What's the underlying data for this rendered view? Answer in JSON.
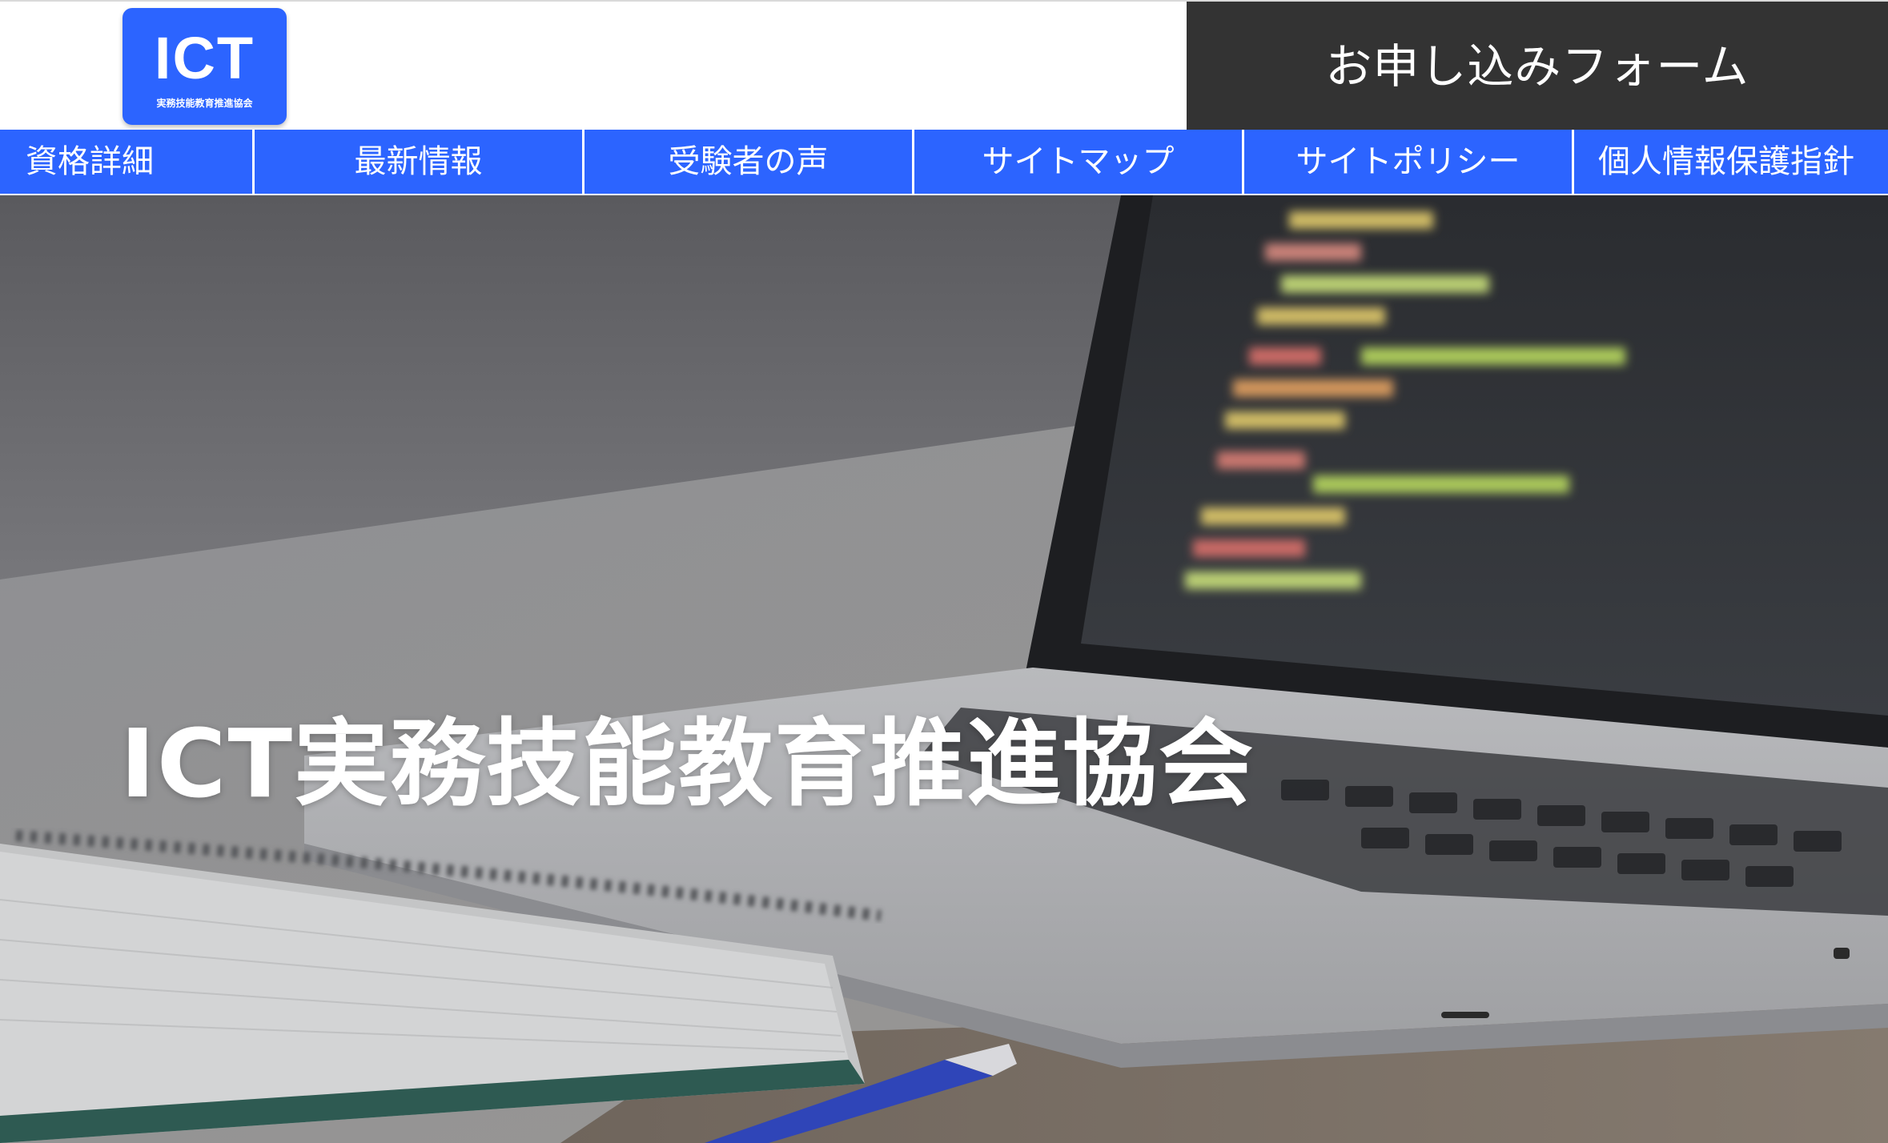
{
  "header": {
    "logo": {
      "mark": "ICT",
      "subtitle": "実務技能教育推進協会"
    },
    "apply_button": "お申し込みフォーム"
  },
  "nav": {
    "items": [
      {
        "label": "資格詳細"
      },
      {
        "label": "最新情報"
      },
      {
        "label": "受験者の声"
      },
      {
        "label": "サイトマップ"
      },
      {
        "label": "サイトポリシー"
      },
      {
        "label": "個人情報保護指針"
      }
    ]
  },
  "hero": {
    "title": "ICT実務技能教育推進協会"
  },
  "colors": {
    "brand_blue": "#2c64ff",
    "apply_button_bg": "#333333"
  }
}
